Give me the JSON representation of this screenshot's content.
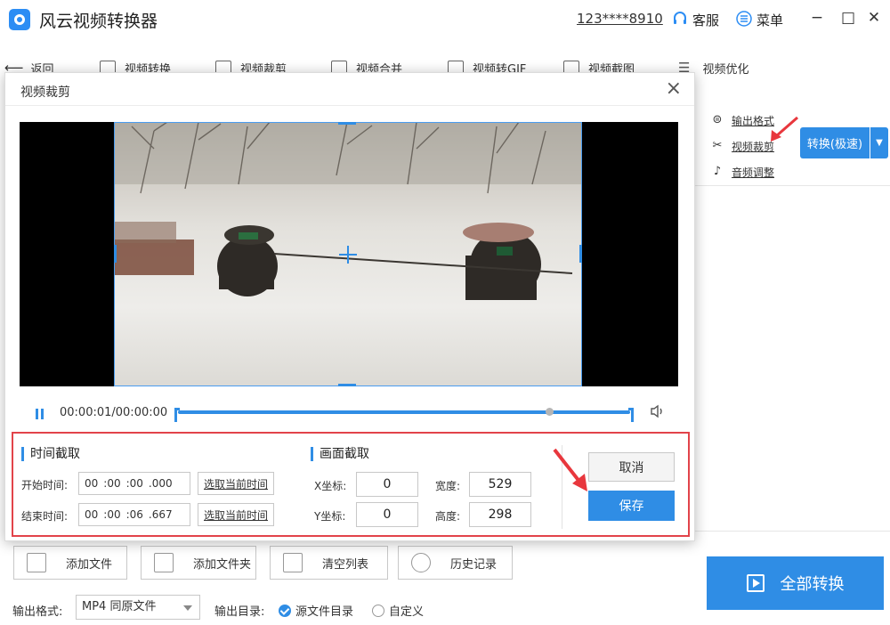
{
  "app": {
    "title": "风云视频转换器",
    "account": "123****8910",
    "service": "客服",
    "menu": "菜单",
    "minimize": "−",
    "maximize": "□",
    "close": "✕"
  },
  "nav": [
    {
      "label": "返回"
    },
    {
      "label": "视频转换"
    },
    {
      "label": "视频裁剪"
    },
    {
      "label": "视频合并"
    },
    {
      "label": "视频转GIF"
    },
    {
      "label": "视频截图"
    },
    {
      "label": "视频优化"
    }
  ],
  "right_panel": {
    "output_format": "输出格式",
    "video_crop": "视频裁剪",
    "audio_adjust": "音频调整",
    "convert_fast": "转换(极速)"
  },
  "dialog": {
    "title": "视频裁剪",
    "close": "×",
    "timecode": "00:00:01/00:00:00",
    "playback": {
      "fraction": 0.82
    },
    "time_section": {
      "title": "时间截取",
      "start_label": "开始时间:",
      "end_label": "结束时间:",
      "start": {
        "h": "00",
        "m": ":00",
        "s": ":00",
        "ms": ".000"
      },
      "end": {
        "h": "00",
        "m": ":00",
        "s": ":06",
        "ms": ".667"
      },
      "pick_label": "选取当前时间"
    },
    "frame_section": {
      "title": "画面截取",
      "x_label": "X坐标:",
      "y_label": "Y坐标:",
      "w_label": "宽度:",
      "h_label": "高度:",
      "x": "0",
      "y": "0",
      "width": "529",
      "height": "298"
    },
    "cancel": "取消",
    "save": "保存"
  },
  "bottom": {
    "add_file": "添加文件",
    "add_folder": "添加文件夹",
    "clear_list": "清空列表",
    "history": "历史记录",
    "convert_all": "全部转换",
    "format_label": "输出格式:",
    "format_value": "MP4 同原文件",
    "dir_label": "输出目录:",
    "dir_source": "源文件目录",
    "dir_custom": "自定义"
  },
  "colors": {
    "accent": "#2f8de5",
    "highlight": "#e2434a"
  },
  "icons": [
    "app-logo-icon",
    "headset-icon",
    "menu-icon",
    "back-arrow-icon",
    "scissors-icon",
    "volume-icon",
    "pause-icon",
    "play-icon"
  ]
}
